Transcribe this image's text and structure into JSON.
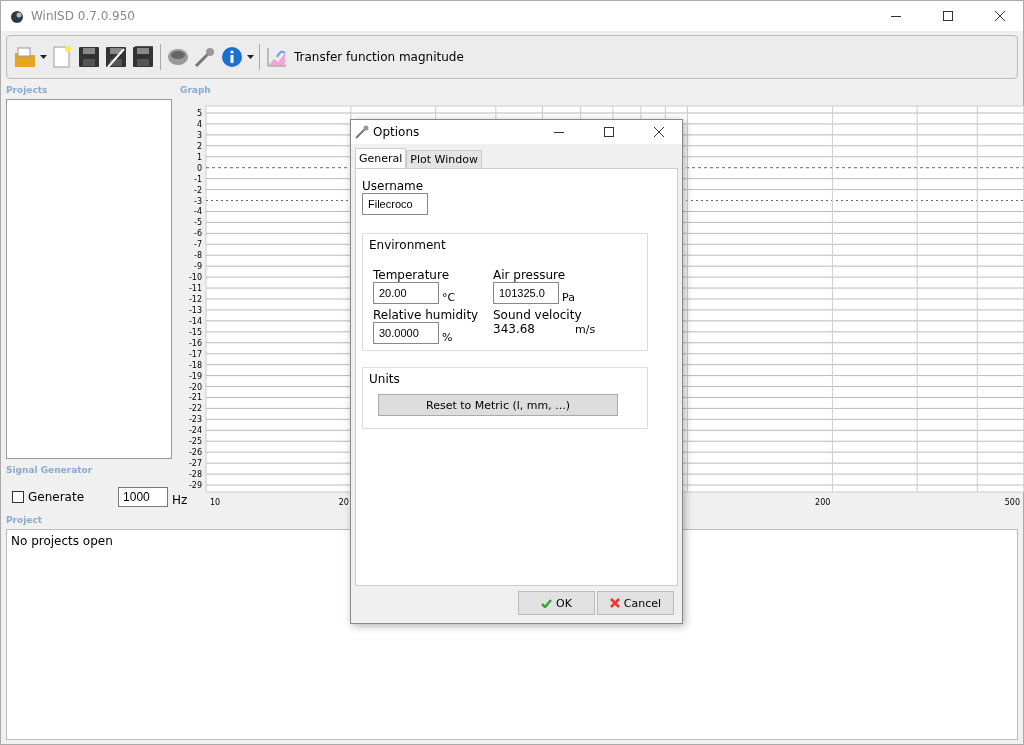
{
  "window": {
    "title": "WinISD 0.7.0.950"
  },
  "toolbar": {
    "mode_label": "Transfer function magnitude"
  },
  "projects": {
    "heading": "Projects"
  },
  "graph": {
    "heading": "Graph",
    "y_ticks": [
      "5",
      "4",
      "3",
      "2",
      "1",
      "0",
      "-1",
      "-2",
      "-3",
      "-4",
      "-5",
      "-6",
      "-7",
      "-8",
      "-9",
      "-10",
      "-11",
      "-12",
      "-13",
      "-14",
      "-15",
      "-16",
      "-17",
      "-18",
      "-19",
      "-20",
      "-21",
      "-22",
      "-23",
      "-24",
      "-25",
      "-26",
      "-27",
      "-28",
      "-29"
    ],
    "x_ticks": [
      "10",
      "20",
      "200",
      "500"
    ]
  },
  "signal_generator": {
    "heading": "Signal Generator",
    "generate_label": "Generate",
    "checked": false,
    "frequency": "1000",
    "unit": "Hz"
  },
  "project": {
    "heading": "Project",
    "message": "No projects open"
  },
  "dialog": {
    "title": "Options",
    "tabs": [
      {
        "label": "General",
        "selected": true
      },
      {
        "label": "Plot Window",
        "selected": false
      }
    ],
    "username_label": "Username",
    "username": "Filecroco",
    "environment": {
      "heading": "Environment",
      "temperature_label": "Temperature",
      "temperature": "20.00",
      "temperature_unit": "°C",
      "pressure_label": "Air pressure",
      "pressure": "101325.0",
      "pressure_unit": "Pa",
      "humidity_label": "Relative humidity",
      "humidity": "30.0000",
      "humidity_unit": "%",
      "velocity_label": "Sound velocity",
      "velocity": "343.68",
      "velocity_unit": "m/s"
    },
    "units": {
      "heading": "Units",
      "reset_button": "Reset to Metric (l, mm, ...)"
    },
    "buttons": [
      {
        "kind": "ok",
        "label": "OK"
      },
      {
        "kind": "cancel",
        "label": "Cancel"
      }
    ]
  }
}
